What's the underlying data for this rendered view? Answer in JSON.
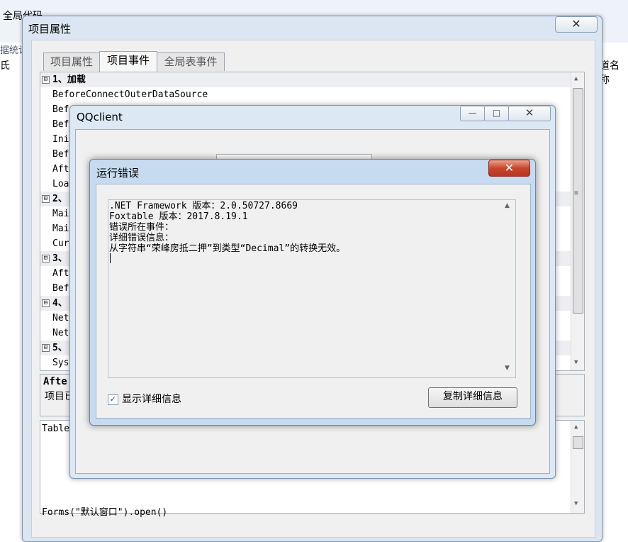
{
  "background": {
    "global_code": "全局代码",
    "stats_text": "据统计",
    "left_col": "氏",
    "right_col": "道名称"
  },
  "project_window": {
    "title": "项目属性",
    "close_glyph": "✕",
    "tabs": [
      "项目属性",
      "项目事件",
      "全局表事件"
    ],
    "active_tab": "项目事件",
    "events": [
      {
        "group": true,
        "sign": "⊟",
        "text": "1、加载"
      },
      {
        "group": false,
        "text": "BeforeConnectOuterDataSource"
      },
      {
        "group": false,
        "text": "Bef"
      },
      {
        "group": false,
        "text": "Bef"
      },
      {
        "group": false,
        "text": "Ini"
      },
      {
        "group": false,
        "text": "Bef"
      },
      {
        "group": false,
        "text": "Aft"
      },
      {
        "group": false,
        "text": "Loa"
      },
      {
        "group": true,
        "sign": "⊟",
        "text": "2、"
      },
      {
        "group": false,
        "text": "Mai"
      },
      {
        "group": false,
        "text": "Mai"
      },
      {
        "group": false,
        "text": "Cur"
      },
      {
        "group": true,
        "sign": "⊟",
        "text": "3、"
      },
      {
        "group": false,
        "text": "Aft"
      },
      {
        "group": false,
        "text": "Bef"
      },
      {
        "group": true,
        "sign": "⊟",
        "text": "4、"
      },
      {
        "group": false,
        "text": "Net"
      },
      {
        "group": false,
        "text": "Net"
      },
      {
        "group": true,
        "sign": "⊟",
        "text": "5、"
      },
      {
        "group": false,
        "text": "Sys"
      }
    ],
    "desc_title": "Afte",
    "desc_body": "项目已",
    "code_line1": "Table",
    "code_last": "Forms(\"默认窗口\").open()"
  },
  "qqclient": {
    "title": "QQclient",
    "min_glyph": "—",
    "max_glyph": "□",
    "close_glyph": "✕"
  },
  "error_dialog": {
    "title": "运行错误",
    "close_glyph": "✕",
    "lines": [
      ".NET Framework 版本：2.0.50727.8669",
      "Foxtable 版本：2017.8.19.1",
      "错误所在事件：",
      "详细错误信息：",
      "从字符串“荣峰房抵二押”到类型“Decimal”的转换无效。"
    ],
    "show_details_label": "显示详细信息",
    "show_details_checked": true,
    "copy_button": "复制详细信息"
  },
  "icons": {
    "scroll_up": "▲",
    "scroll_down": "▼",
    "check": "✓",
    "scroll_grip": "≡"
  }
}
